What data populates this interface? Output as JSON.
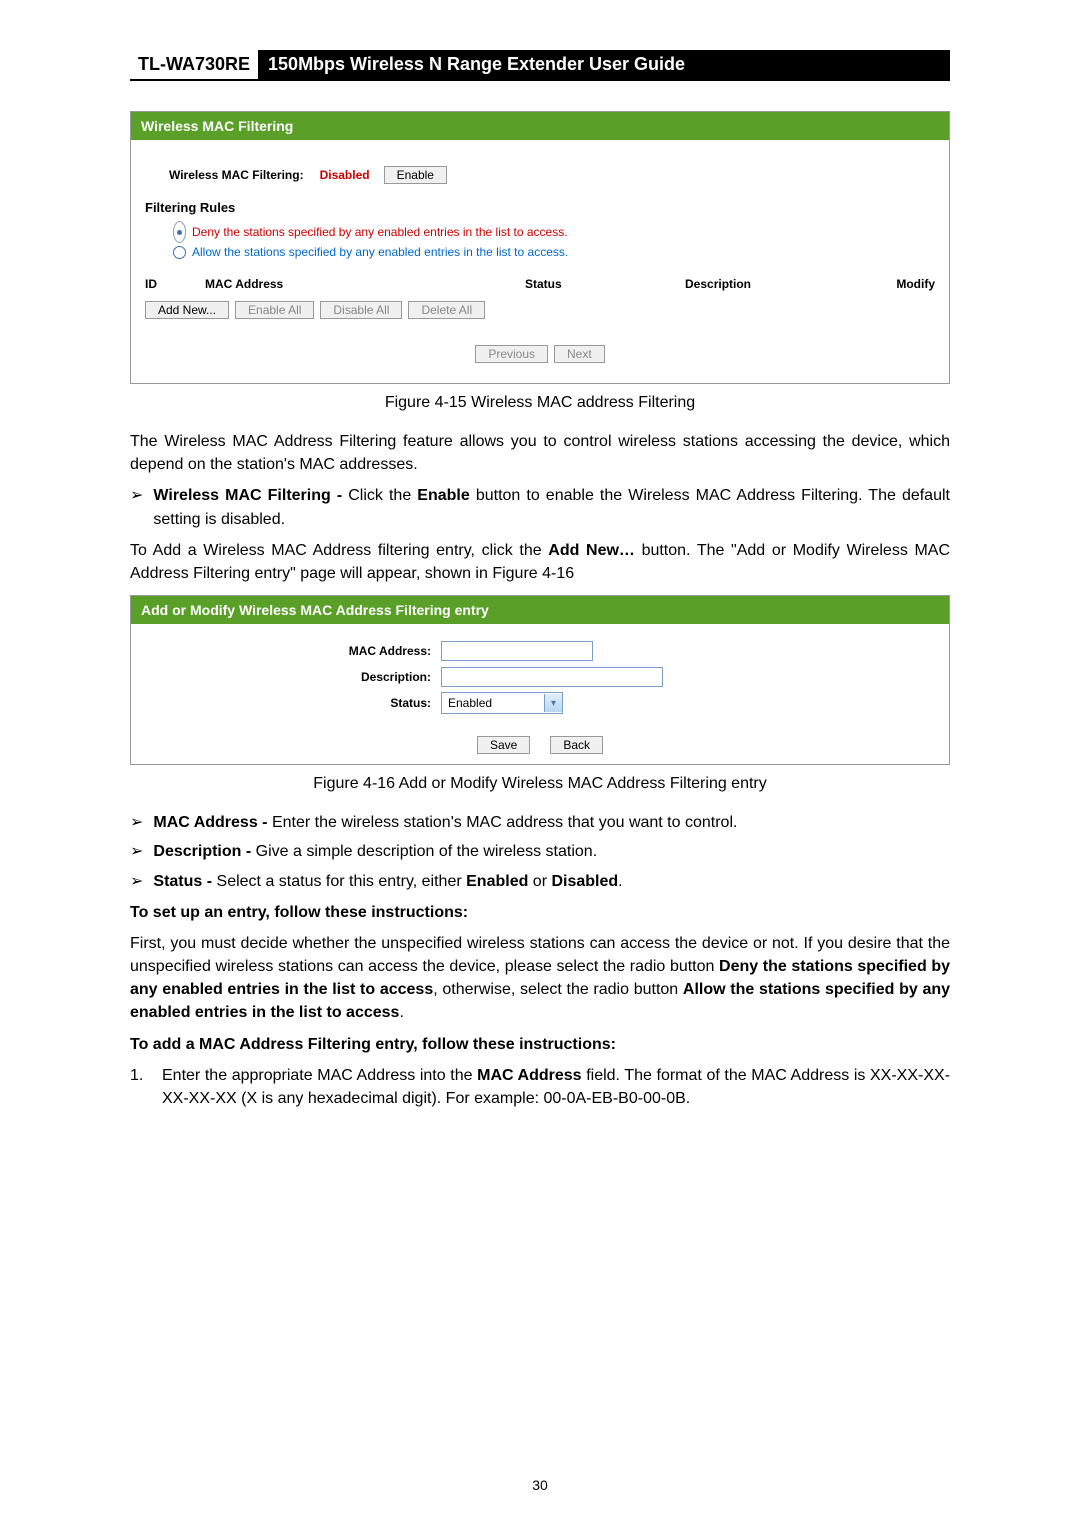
{
  "header": {
    "model": "TL-WA730RE",
    "title": "150Mbps Wireless N Range Extender User Guide"
  },
  "fig1": {
    "panel_title": "Wireless MAC Filtering",
    "toggle_label": "Wireless MAC Filtering:",
    "status_text": "Disabled",
    "enable_btn": "Enable",
    "rules_head": "Filtering Rules",
    "radio_deny": "Deny the stations specified by any enabled entries in the list to access.",
    "radio_allow": "Allow the stations specified by any enabled entries in the list to access.",
    "col_id": "ID",
    "col_mac": "MAC Address",
    "col_status": "Status",
    "col_desc": "Description",
    "col_modify": "Modify",
    "btn_add": "Add New...",
    "btn_enable_all": "Enable All",
    "btn_disable_all": "Disable All",
    "btn_delete_all": "Delete All",
    "btn_prev": "Previous",
    "btn_next": "Next",
    "caption": "Figure 4-15 Wireless MAC address Filtering"
  },
  "body": {
    "intro": "The Wireless MAC Address Filtering feature allows you to control wireless stations accessing the device, which depend on the station's MAC addresses.",
    "b1_strong": "Wireless MAC Filtering -",
    "b1_rest_a": " Click the ",
    "b1_rest_b": "Enable",
    "b1_rest_c": " button to enable the Wireless MAC Address Filtering. The default setting is disabled.",
    "add_intro_a": "To Add a Wireless MAC Address filtering entry, click the ",
    "add_intro_b": "Add New…",
    "add_intro_c": " button. The \"Add or Modify Wireless MAC Address Filtering entry\" page will appear, shown in Figure 4-16"
  },
  "fig2": {
    "panel_title": "Add or Modify Wireless MAC Address Filtering entry",
    "lbl_mac": "MAC Address:",
    "lbl_desc": "Description:",
    "lbl_status": "Status:",
    "sel_value": "Enabled",
    "btn_save": "Save",
    "btn_back": "Back",
    "caption": "Figure 4-16 Add or Modify Wireless MAC Address Filtering entry"
  },
  "bullets2": {
    "mac_b": "MAC Address -",
    "mac_t": " Enter the wireless station's MAC address that you want to control.",
    "desc_b": "Description -",
    "desc_t": " Give a simple description of the wireless station.",
    "stat_b": "Status -",
    "stat_t1": " Select a status for this entry, either ",
    "stat_en": "Enabled",
    "stat_or": " or ",
    "stat_dis": "Disabled",
    "stat_dot": "."
  },
  "instr": {
    "h1": "To set up an entry, follow these instructions:",
    "p1a": "First, you must decide whether the unspecified wireless stations can access the device or not. If you desire that the unspecified wireless stations can access the device, please select the radio button ",
    "p1b": "Deny the stations specified by any enabled entries in the list to access",
    "p1c": ", otherwise, select the radio button ",
    "p1d": "Allow the stations specified by any enabled entries in the list to access",
    "p1e": ".",
    "h2": "To add a MAC Address Filtering entry, follow these instructions:",
    "n1a": "Enter the appropriate MAC Address into the ",
    "n1b": "MAC Address",
    "n1c": " field. The format of the MAC Address is XX-XX-XX-XX-XX-XX (X is any hexadecimal digit). For example: 00-0A-EB-B0-00-0B."
  },
  "page_number": "30"
}
